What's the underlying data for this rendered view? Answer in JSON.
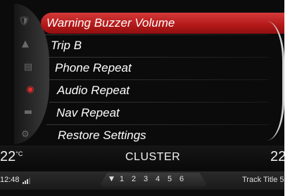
{
  "menu": {
    "items": [
      {
        "label": "Warning Buzzer Volume",
        "selected": true
      },
      {
        "label": "Trip B",
        "selected": false
      },
      {
        "label": "Phone Repeat",
        "selected": false
      },
      {
        "label": "Audio Repeat",
        "selected": false
      },
      {
        "label": "Nav Repeat",
        "selected": false
      },
      {
        "label": "Restore Settings",
        "selected": false
      }
    ]
  },
  "rail": {
    "icons": [
      "shield-icon",
      "warning-icon",
      "fuel-icon",
      "steering-icon",
      "battery-icon",
      "gear-icon"
    ]
  },
  "status": {
    "temp_left": "22",
    "temp_unit": "°C",
    "title": "CLUSTER",
    "temp_right": "22",
    "clock": "12:48",
    "presets": [
      "1",
      "2",
      "3",
      "4",
      "5",
      "6"
    ],
    "track": "Track Title 5"
  },
  "colors": {
    "selected_red": "#c42020",
    "background": "#0b0b0b",
    "text": "#ffffff"
  }
}
